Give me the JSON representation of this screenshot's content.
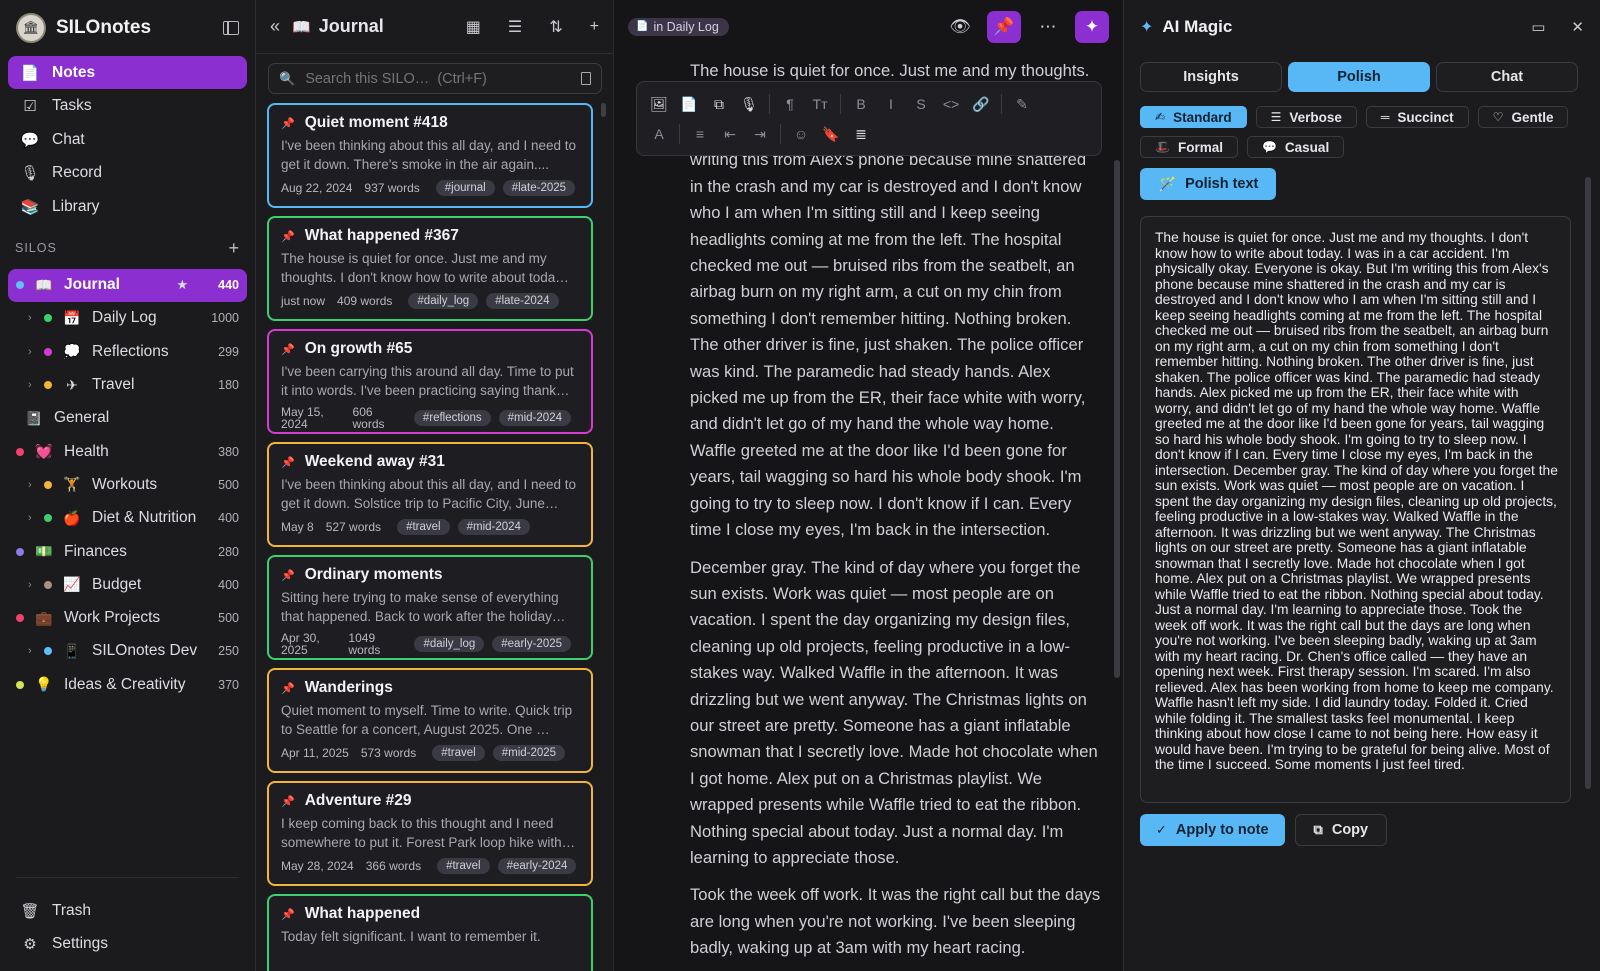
{
  "sidebar": {
    "app_name": "SILOnotes",
    "logo_text": "🏛",
    "nav": [
      {
        "label": "Notes",
        "icon": "📄",
        "active": true
      },
      {
        "label": "Tasks",
        "icon": "☑"
      },
      {
        "label": "Chat",
        "icon": "💬"
      },
      {
        "label": "Record",
        "icon": "🎙"
      },
      {
        "label": "Library",
        "icon": "📚"
      }
    ],
    "silos_label": "SILOS",
    "silos_add": "+",
    "silos": [
      {
        "name": "Journal",
        "icon": "📖",
        "dot": "#5ec0f7",
        "count": "440",
        "star": "★",
        "active": true
      },
      {
        "name": "Daily Log",
        "icon": "📅",
        "dot": "#3ccf6e",
        "count": "1000",
        "child": true
      },
      {
        "name": "Reflections",
        "icon": "💭",
        "dot": "#d63ad0",
        "count": "299",
        "child": true
      },
      {
        "name": "Travel",
        "icon": "✈",
        "dot": "#f2b43a",
        "count": "180",
        "child": true
      },
      {
        "name": "General",
        "icon": "📓",
        "count": "",
        "plain": true
      },
      {
        "name": "Health",
        "icon": "💓",
        "dot": "#f0436b",
        "count": "380"
      },
      {
        "name": "Workouts",
        "icon": "🏋",
        "dot": "#f2b43a",
        "count": "500",
        "child": true
      },
      {
        "name": "Diet & Nutrition",
        "icon": "🍎",
        "dot": "#3ccf6e",
        "count": "400",
        "child": true
      },
      {
        "name": "Finances",
        "icon": "💵",
        "dot": "#8d7ae6",
        "count": "280"
      },
      {
        "name": "Budget",
        "icon": "📈",
        "dot": "#a78e86",
        "count": "400",
        "child": true
      },
      {
        "name": "Work Projects",
        "icon": "💼",
        "dot": "#f0436b",
        "count": "500"
      },
      {
        "name": "SILOnotes Dev",
        "icon": "📱",
        "dot": "#5ec0f7",
        "count": "250",
        "child": true
      },
      {
        "name": "Ideas & Creativity",
        "icon": "💡",
        "dot": "#d8e05a",
        "count": "370"
      }
    ],
    "footer": [
      {
        "label": "Trash",
        "icon": "🗑"
      },
      {
        "label": "Settings",
        "icon": "⚙"
      }
    ]
  },
  "list": {
    "back": "«",
    "icon": "📖",
    "title": "Journal",
    "buttons": [
      "▦",
      "☰",
      "⇅",
      "+"
    ],
    "search_placeholder": "Search this SILO…  (Ctrl+F)",
    "cards": [
      {
        "title": "Quiet moment #418",
        "border": "#58b7f5",
        "snippet": "I've been thinking about this all day, and I need to get it down. There's smoke in the air again....",
        "date": "Aug 22, 2024",
        "words": "937 words",
        "tags": [
          "#journal",
          "#late-2025"
        ]
      },
      {
        "title": "What happened #367",
        "border": "#3ccf6e",
        "snippet": "The house is quiet for once. Just me and my thoughts. I don't know how to write about toda…",
        "date": "just now",
        "words": "409 words",
        "tags": [
          "#daily_log",
          "#late-2024"
        ]
      },
      {
        "title": "On growth #65",
        "border": "#d63ad0",
        "snippet": "I've been carrying this around all day. Time to put it into words. I've been practicing saying thank…",
        "date": "May 15, 2024",
        "words": "606 words",
        "tags": [
          "#reflections",
          "#mid-2024"
        ],
        "wrap": true
      },
      {
        "title": "Weekend away #31",
        "border": "#f2b43a",
        "snippet": "I've been thinking about this all day, and I need to get it down. Solstice trip to Pacific City, June…",
        "date": "May 8",
        "words": "527 words",
        "tags": [
          "#travel",
          "#mid-2024"
        ]
      },
      {
        "title": "Ordinary moments",
        "border": "#3ccf6e",
        "snippet": "Sitting here trying to make sense of everything that happened. Back to work after the holiday…",
        "date": "Apr 30, 2025",
        "words": "1049 words",
        "tags": [
          "#daily_log",
          "#early-2025"
        ],
        "wrap": true
      },
      {
        "title": "Wanderings",
        "border": "#f2b43a",
        "snippet": "Quiet moment to myself. Time to write. Quick trip to Seattle for a concert, August 2025. One …",
        "date": "Apr 11, 2025",
        "words": "573 words",
        "tags": [
          "#travel",
          "#mid-2025"
        ]
      },
      {
        "title": "Adventure #29",
        "border": "#f2b43a",
        "snippet": "I keep coming back to this thought and I need somewhere to put it. Forest Park loop hike with…",
        "date": "May 28, 2024",
        "words": "366 words",
        "tags": [
          "#travel",
          "#early-2024"
        ]
      },
      {
        "title": "What happened",
        "border": "#3ccf6e",
        "snippet": "Today felt significant. I want to remember it.",
        "date": "",
        "words": "",
        "tags": []
      }
    ]
  },
  "editor": {
    "crumb": "in Daily Log",
    "crumb_icon": "📄",
    "buttons": {
      "view": "👁",
      "pin": "📌",
      "more": "⋯",
      "magic": "✦"
    },
    "toolbar_row1": [
      "🖼",
      "📄",
      "⧉",
      "🎙",
      "¶",
      "Tт",
      "B",
      "I",
      "S",
      "<>",
      "🔗",
      "✎"
    ],
    "toolbar_row2": [
      "A",
      "≡",
      "⇤",
      "⇥",
      "☺",
      "🔖",
      "≣"
    ],
    "first_line": "The house is quiet for once. Just me and my thoughts.",
    "paragraphs": [
      "writing this from Alex's phone because mine shattered in the crash and my car is destroyed and I don't know who I am when I'm sitting still and I keep seeing headlights coming at me from the left. The hospital checked me out — bruised ribs from the seatbelt, an airbag burn on my right arm, a cut on my chin from something I don't remember hitting. Nothing broken. The other driver is fine, just shaken. The police officer was kind. The paramedic had steady hands. Alex picked me up from the ER, their face white with worry, and didn't let go of my hand the whole way home. Waffle greeted me at the door like I'd been gone for years, tail wagging so hard his whole body shook. I'm going to try to sleep now. I don't know if I can. Every time I close my eyes, I'm back in the intersection.",
      "December gray. The kind of day where you forget the sun exists. Work was quiet — most people are on vacation. I spent the day organizing my design files, cleaning up old projects, feeling productive in a low-stakes way. Walked Waffle in the afternoon. It was drizzling but we went anyway. The Christmas lights on our street are pretty. Someone has a giant inflatable snowman that I secretly love. Made hot chocolate when I got home. Alex put on a Christmas playlist. We wrapped presents while Waffle tried to eat the ribbon. Nothing special about today. Just a normal day. I'm learning to appreciate those.",
      "Took the week off work. It was the right call but the days are long when you're not working. I've been sleeping badly, waking up at 3am with my heart racing."
    ]
  },
  "ai": {
    "icon": "✦",
    "title": "AI Magic",
    "buttons": {
      "minimize": "▭",
      "close": "✕"
    },
    "tabs": [
      {
        "label": "Insights"
      },
      {
        "label": "Polish",
        "active": true
      },
      {
        "label": "Chat"
      }
    ],
    "styles": [
      {
        "label": "Standard",
        "icon": "✍",
        "active": true
      },
      {
        "label": "Verbose",
        "icon": "☰"
      },
      {
        "label": "Succinct",
        "icon": "═"
      },
      {
        "label": "Gentle",
        "icon": "♡"
      },
      {
        "label": "Formal",
        "icon": "🎩"
      },
      {
        "label": "Casual",
        "icon": "💬"
      }
    ],
    "polish_label": "Polish text",
    "polish_icon": "🪄",
    "result": "The house is quiet for once. Just me and my thoughts. I don't know how to write about today. I was in a car accident. I'm physically okay. Everyone is okay. But I'm writing this from Alex's phone because mine shattered in the crash and my car is destroyed and I don't know who I am when I'm sitting still and I keep seeing headlights coming at me from the left. The hospital checked me out — bruised ribs from the seatbelt, an airbag burn on my right arm, a cut on my chin from something I don't remember hitting. Nothing broken. The other driver is fine, just shaken. The police officer was kind. The paramedic had steady hands. Alex picked me up from the ER, their face white with worry, and didn't let go of my hand the whole way home. Waffle greeted me at the door like I'd been gone for years, tail wagging so hard his whole body shook. I'm going to try to sleep now. I don't know if I can. Every time I close my eyes, I'm back in the intersection. December gray. The kind of day where you forget the sun exists. Work was quiet — most people are on vacation. I spent the day organizing my design files, cleaning up old projects, feeling productive in a low-stakes way. Walked Waffle in the afternoon. It was drizzling but we went anyway. The Christmas lights on our street are pretty. Someone has a giant inflatable snowman that I secretly love. Made hot chocolate when I got home. Alex put on a Christmas playlist. We wrapped presents while Waffle tried to eat the ribbon. Nothing special about today. Just a normal day. I'm learning to appreciate those. Took the week off work. It was the right call but the days are long when you're not working. I've been sleeping badly, waking up at 3am with my heart racing. Dr. Chen's office called — they have an opening next week. First therapy session. I'm scared. I'm also relieved. Alex has been working from home to keep me company. Waffle hasn't left my side. I did laundry today. Folded it. Cried while folding it. The smallest tasks feel monumental. I keep thinking about how close I came to not being here. How easy it would have been. I'm trying to be grateful for being alive. Most of the time I succeed. Some moments I just feel tired.",
    "apply_label": "Apply to note",
    "apply_icon": "✓",
    "copy_label": "Copy",
    "copy_icon": "⧉"
  }
}
